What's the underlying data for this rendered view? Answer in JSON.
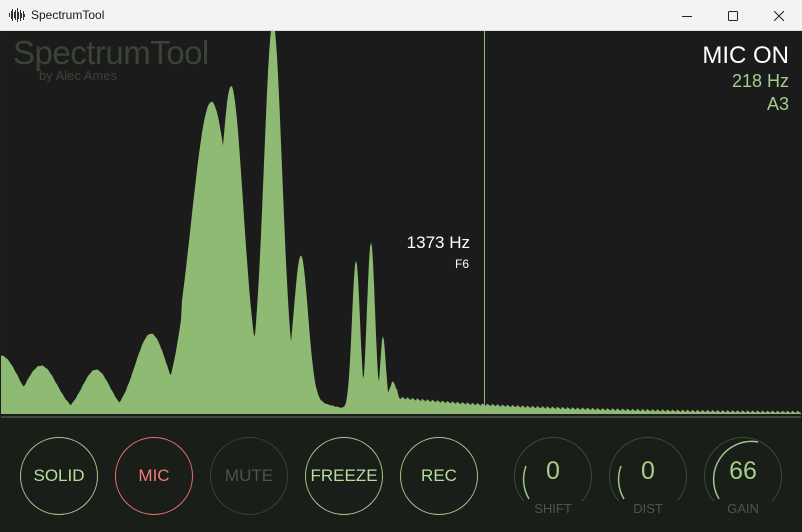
{
  "window": {
    "title": "SpectrumTool",
    "app_icon": "waveform-icon",
    "minimize_icon": "minimize-icon",
    "maximize_icon": "maximize-icon",
    "close_icon": "close-icon"
  },
  "logo": {
    "title": "SpectrumTool",
    "subtitle": "by Alec Ames"
  },
  "status": {
    "mic_state": "MIC ON",
    "frequency": "218 Hz",
    "note": "A3"
  },
  "cursor": {
    "frequency": "1373 Hz",
    "note": "F6"
  },
  "colors": {
    "spectrum_fill": "#8fba73",
    "accent": "#a6cd8a",
    "mic_red": "#e5716a",
    "background": "#1b1b1b"
  },
  "buttons": {
    "solid": "SOLID",
    "mic": "MIC",
    "mute": "MUTE",
    "freeze": "FREEZE",
    "rec": "REC"
  },
  "knobs": {
    "shift": {
      "value": "0",
      "label": "SHIFT"
    },
    "dist": {
      "value": "0",
      "label": "DIST"
    },
    "gain": {
      "value": "66",
      "label": "GAIN"
    }
  }
}
